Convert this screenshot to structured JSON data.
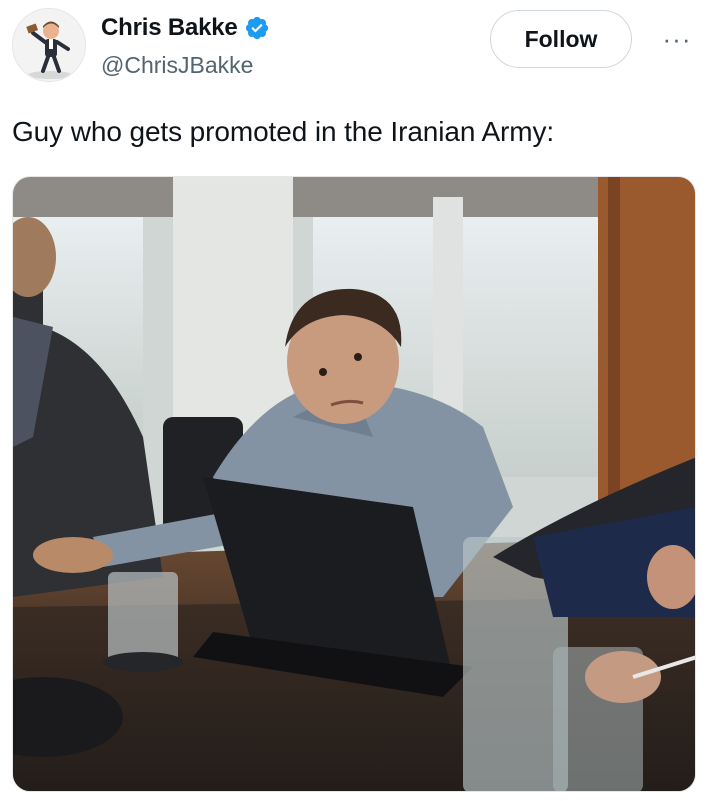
{
  "tweet": {
    "display_name": "Chris Bakke",
    "handle": "@ChrisJBakke",
    "text": "Guy who gets promoted in the Iranian Army:",
    "verified": true
  },
  "actions": {
    "follow_label": "Follow",
    "more_label": "···"
  },
  "colors": {
    "verified_blue": "#1d9bf0",
    "text_primary": "#0f1419",
    "text_secondary": "#536471",
    "border": "#cfd9de"
  },
  "icons": {
    "verified": "verified-badge-icon",
    "more": "more-dots-icon"
  }
}
